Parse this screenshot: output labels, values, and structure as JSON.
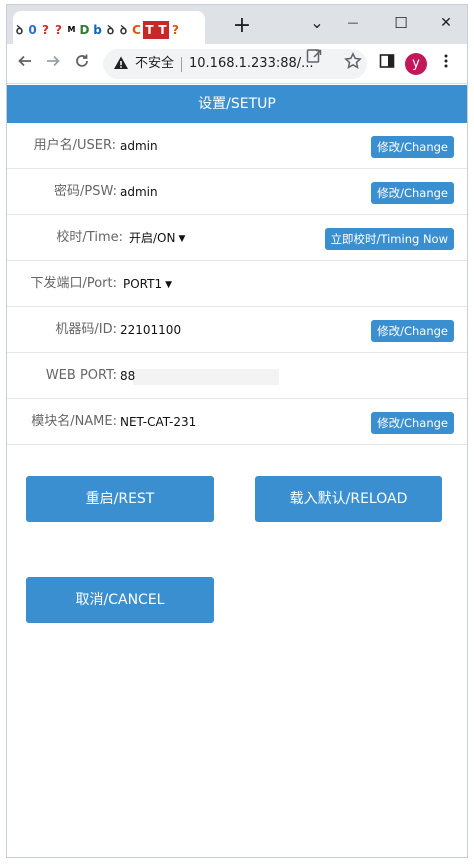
{
  "browser": {
    "favicons": [
      "ꝺ",
      "0",
      "?",
      "?",
      "M",
      "D",
      "b",
      "ꝺ",
      "ꝺ",
      "C",
      "T",
      "T",
      "?"
    ],
    "new_tab_label": "+",
    "window_controls": {
      "tabs_menu": "⌄",
      "minimize": "—",
      "maximize": "☐",
      "close": "✕"
    },
    "security_label": "不安全",
    "url": "10.168.1.233:88/...",
    "profile_initial": "y"
  },
  "header": {
    "title": "设置/SETUP"
  },
  "form": {
    "rows": [
      {
        "label": "用户名/USER:",
        "value": "admin",
        "button": "修改/Change"
      },
      {
        "label": "密码/PSW:",
        "value": "admin",
        "button": "修改/Change"
      },
      {
        "label": "校时/Time:",
        "value": "开启/ON",
        "button": "立即校时/Timing Now"
      },
      {
        "label": "下发端口/Port:",
        "value": "PORT1"
      },
      {
        "label": "机器码/ID:",
        "value": "22101100",
        "button": "修改/Change"
      },
      {
        "label": "WEB PORT:",
        "value": "88"
      },
      {
        "label": "模块名/NAME:",
        "value": "NET-CAT-231",
        "button": "修改/Change"
      }
    ]
  },
  "actions": {
    "restart": "重启/REST",
    "reload": "载入默认/RELOAD",
    "cancel": "取消/CANCEL"
  },
  "colors": {
    "accent": "#3a8fd1"
  }
}
